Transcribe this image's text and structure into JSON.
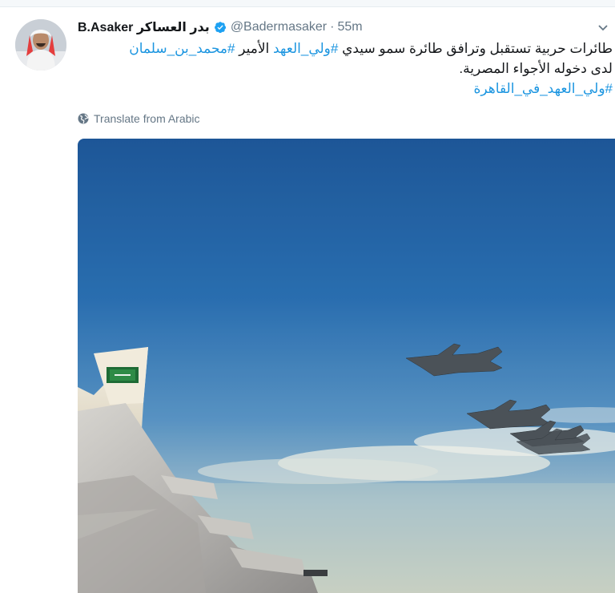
{
  "tweet": {
    "display_name_ar": "بدر العساكر",
    "display_name_en": "B.Asaker",
    "handle": "@Badermasaker",
    "separator": "·",
    "time": "55m",
    "text": {
      "line1": "طائرات حربية تستقبل وترافق طائرة سمو سيدي",
      "line1_hashtag": "#ولي_العهد",
      "line1_rest": "الأمير",
      "line1_hashtag2": "#محمد_بن_سلمان",
      "line2": "لدى دخوله الأجواء المصرية.",
      "line3_hashtag": "#ولي_العهد_في_القاهرة"
    },
    "translate_label": "Translate from Arabic"
  },
  "icons": {
    "verified": "verified-badge-icon",
    "caret": "chevron-down-icon",
    "globe": "globe-icon"
  },
  "colors": {
    "link": "#1b95e0",
    "muted": "#657786",
    "verified": "#1da1f2"
  }
}
